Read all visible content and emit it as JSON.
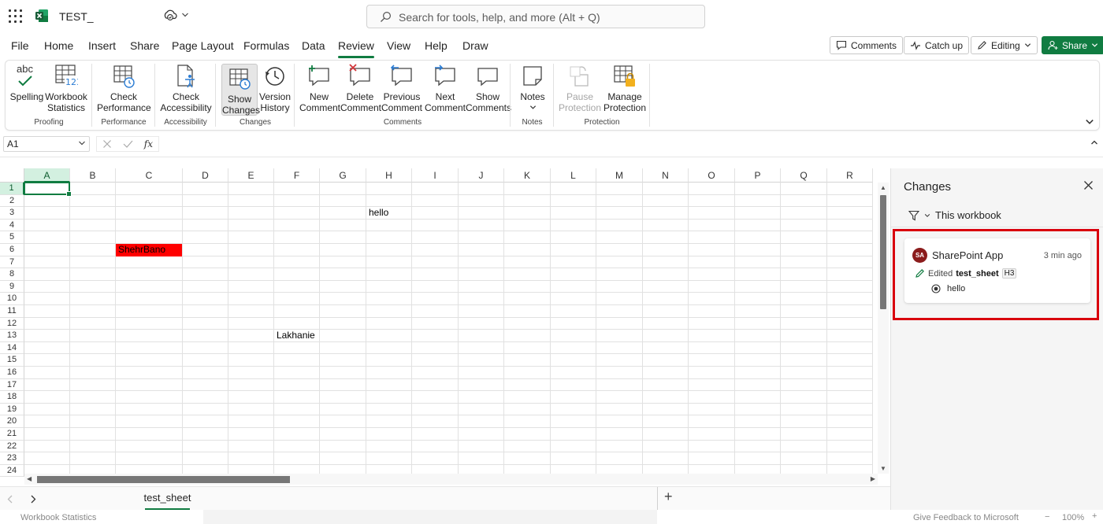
{
  "title_bar": {
    "doc_title": "TEST_",
    "search_placeholder": "Search for tools, help, and more (Alt + Q)"
  },
  "menu": {
    "tabs": [
      "File",
      "Home",
      "Insert",
      "Share",
      "Page Layout",
      "Formulas",
      "Data",
      "Review",
      "View",
      "Help",
      "Draw"
    ],
    "active_tab": "Review",
    "right_buttons": {
      "comments": "Comments",
      "catch_up": "Catch up",
      "editing": "Editing",
      "share": "Share"
    }
  },
  "ribbon": {
    "groups": [
      {
        "label": "Proofing",
        "items": [
          {
            "line1": "Spelling",
            "line2": ""
          },
          {
            "line1": "Workbook",
            "line2": "Statistics"
          }
        ]
      },
      {
        "label": "Performance",
        "items": [
          {
            "line1": "Check",
            "line2": "Performance"
          }
        ]
      },
      {
        "label": "Accessibility",
        "items": [
          {
            "line1": "Check",
            "line2": "Accessibility"
          }
        ]
      },
      {
        "label": "Changes",
        "items": [
          {
            "line1": "Show",
            "line2": "Changes"
          },
          {
            "line1": "Version",
            "line2": "History"
          }
        ]
      },
      {
        "label": "Comments",
        "items": [
          {
            "line1": "New",
            "line2": "Comment"
          },
          {
            "line1": "Delete",
            "line2": "Comment"
          },
          {
            "line1": "Previous",
            "line2": "Comment"
          },
          {
            "line1": "Next",
            "line2": "Comment"
          },
          {
            "line1": "Show",
            "line2": "Comments"
          }
        ]
      },
      {
        "label": "Notes",
        "items": [
          {
            "line1": "Notes",
            "line2": ""
          }
        ]
      },
      {
        "label": "Protection",
        "items": [
          {
            "line1": "Pause",
            "line2": "Protection"
          },
          {
            "line1": "Manage",
            "line2": "Protection"
          }
        ]
      }
    ],
    "spelling_icon_text": "abc",
    "stats_icon_text": "123"
  },
  "formula_bar": {
    "name_box": "A1",
    "fx": "fx"
  },
  "grid": {
    "columns": [
      "A",
      "B",
      "C",
      "D",
      "E",
      "F",
      "G",
      "H",
      "I",
      "J",
      "K",
      "L",
      "M",
      "N",
      "O",
      "P",
      "Q",
      "R"
    ],
    "rows": [
      "1",
      "2",
      "3",
      "4",
      "5",
      "6",
      "7",
      "8",
      "9",
      "10",
      "11",
      "12",
      "13",
      "14",
      "15",
      "16",
      "17",
      "18",
      "19",
      "20",
      "21",
      "22",
      "23",
      "24"
    ],
    "selected_cell": "A1",
    "cells": {
      "H3": "hello",
      "C6": "ShehrBano",
      "F13": "Lakhanie"
    },
    "c6_fill": "#ff0000"
  },
  "sheets": {
    "active": "test_sheet"
  },
  "status_bar": {
    "left": "Workbook Statistics",
    "feedback": "Give Feedback to Microsoft",
    "zoom": "100%"
  },
  "changes_pane": {
    "title": "Changes",
    "filter": "This workbook",
    "card": {
      "avatar_initials": "SA",
      "author": "SharePoint App",
      "time": "3 min ago",
      "action": "Edited",
      "sheet": "test_sheet",
      "cell": "H3",
      "value": "hello"
    },
    "highlight_color": "#d9000d"
  },
  "colors": {
    "accent": "#107c41",
    "avatar": "#8b1c1c"
  }
}
